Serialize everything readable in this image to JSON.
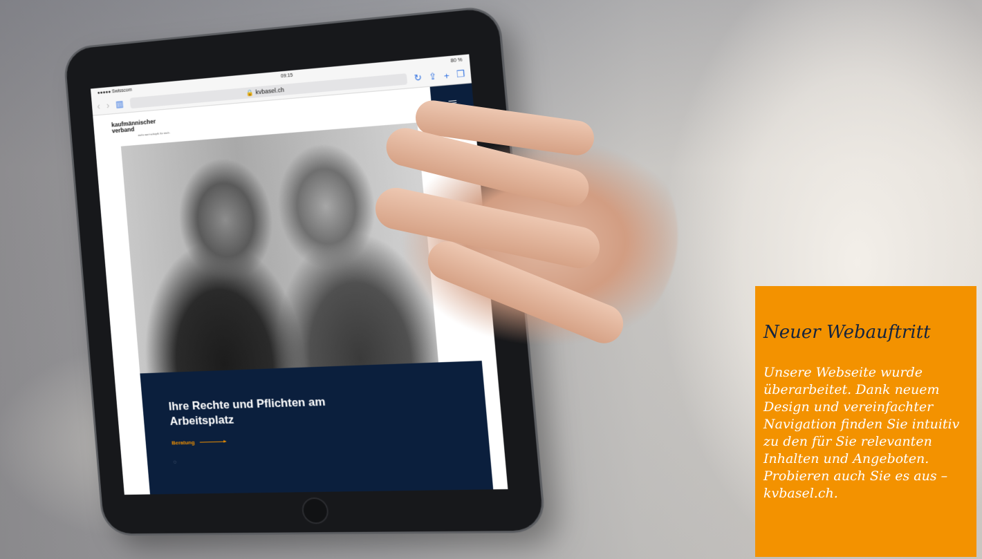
{
  "tablet": {
    "status_bar": {
      "carrier": "●●●●● Swisscom",
      "time": "09:15",
      "battery": "80 %"
    },
    "browser": {
      "url": "kvbasel.ch",
      "lock_icon": "lock-icon"
    },
    "site": {
      "logo_line1": "kaufmännischer",
      "logo_line2": "verband",
      "logo_claim": "mehr wert·schöpft. für mich.",
      "headline": "Ihre Rechte und Pflichten am Arbeitsplatz",
      "link_label": "Beratung",
      "pager": "◌"
    }
  },
  "promo": {
    "title": "Neuer Webauftritt",
    "body": "Unsere Webseite wurde überarbeitet. Dank neuem Design und vereinfachter Navigation finden Sie intuitiv zu den für Sie relevanten Inhalten und Angeboten. Probieren auch Sie es aus – kvbasel.ch."
  },
  "colors": {
    "accent": "#f39200",
    "navy": "#0b1f3d"
  }
}
